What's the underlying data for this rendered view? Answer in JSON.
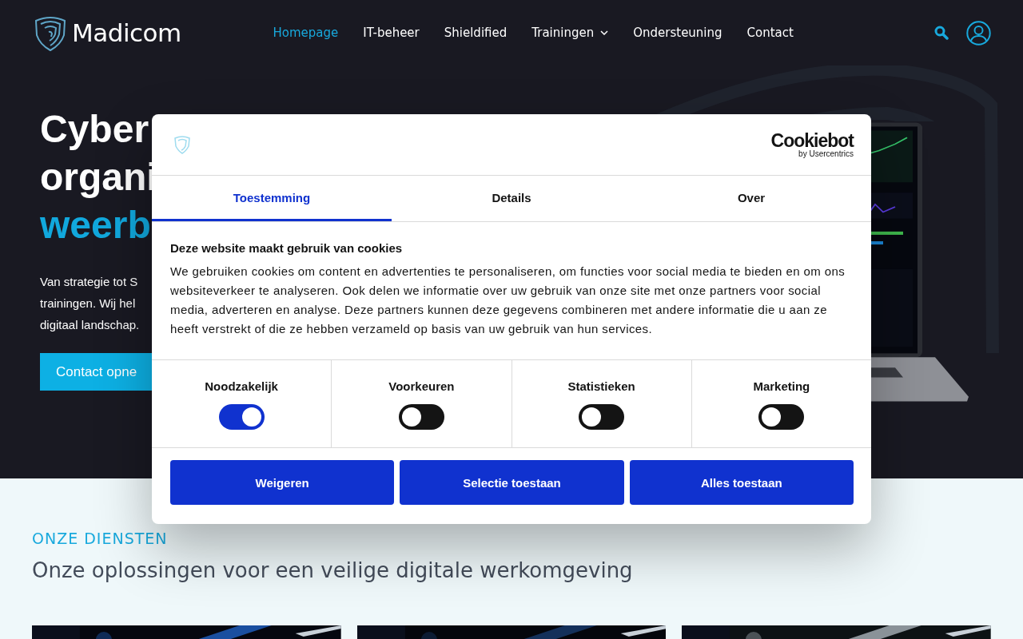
{
  "header": {
    "logo_text": "Madicom",
    "nav": [
      {
        "label": "Homepage",
        "selected": true,
        "dropdown": false
      },
      {
        "label": "IT-beheer",
        "selected": false,
        "dropdown": false
      },
      {
        "label": "Shieldified",
        "selected": false,
        "dropdown": false
      },
      {
        "label": "Trainingen",
        "selected": false,
        "dropdown": true
      },
      {
        "label": "Ondersteuning",
        "selected": false,
        "dropdown": false
      },
      {
        "label": "Contact",
        "selected": false,
        "dropdown": false
      }
    ]
  },
  "hero": {
    "title_lines": [
      {
        "text": "Cyber",
        "accent": false
      },
      {
        "text": "organi",
        "accent": false
      },
      {
        "text": "weerb",
        "accent": true
      }
    ],
    "text_lines": [
      "Van strategie tot S",
      "trainingen. Wij hel",
      "digitaal landschap."
    ],
    "button": "Contact opne"
  },
  "cookie_dialog": {
    "brand": "Cookiebot",
    "brand_sub": "by Usercentrics",
    "tabs": [
      {
        "label": "Toestemming",
        "selected": true
      },
      {
        "label": "Details",
        "selected": false
      },
      {
        "label": "Over",
        "selected": false
      }
    ],
    "heading": "Deze website maakt gebruik van cookies",
    "text": "We gebruiken cookies om content en advertenties te personaliseren, om functies voor social media te bieden en om ons websiteverkeer te analyseren. Ook delen we informatie over uw gebruik van onze site met onze partners voor social media, adverteren en analyse. Deze partners kunnen deze gegevens combineren met andere informatie die u aan ze heeft verstrekt of die ze hebben verzameld op basis van uw gebruik van hun services.",
    "categories": [
      {
        "label": "Noodzakelijk",
        "on": true
      },
      {
        "label": "Voorkeuren",
        "on": false
      },
      {
        "label": "Statistieken",
        "on": false
      },
      {
        "label": "Marketing",
        "on": false
      }
    ],
    "buttons": [
      "Weigeren",
      "Selectie toestaan",
      "Alles toestaan"
    ]
  },
  "services": {
    "eyebrow": "ONZE DIENSTEN",
    "heading": "Onze oplossingen voor een veilige digitale werkomgeving"
  }
}
